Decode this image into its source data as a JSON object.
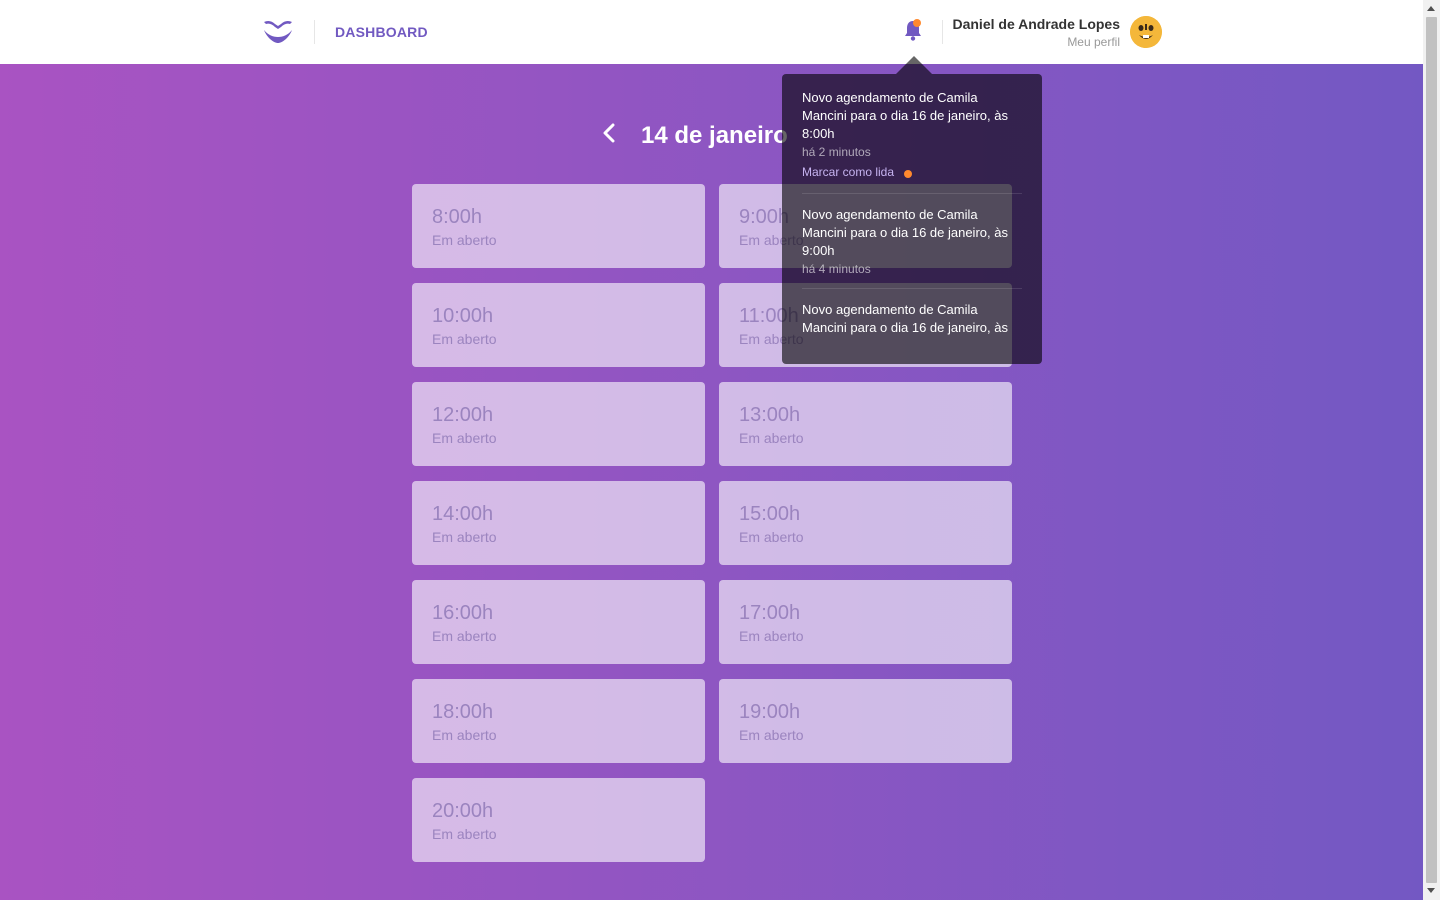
{
  "header": {
    "nav_label": "DASHBOARD",
    "user_name": "Daniel de Andrade Lopes",
    "profile_link": "Meu perfil"
  },
  "schedule": {
    "date_title": "14 de janeiro",
    "slots": [
      {
        "time": "8:00h",
        "status": "Em aberto"
      },
      {
        "time": "9:00h",
        "status": "Em aberto"
      },
      {
        "time": "10:00h",
        "status": "Em aberto"
      },
      {
        "time": "11:00h",
        "status": "Em aberto"
      },
      {
        "time": "12:00h",
        "status": "Em aberto"
      },
      {
        "time": "13:00h",
        "status": "Em aberto"
      },
      {
        "time": "14:00h",
        "status": "Em aberto"
      },
      {
        "time": "15:00h",
        "status": "Em aberto"
      },
      {
        "time": "16:00h",
        "status": "Em aberto"
      },
      {
        "time": "17:00h",
        "status": "Em aberto"
      },
      {
        "time": "18:00h",
        "status": "Em aberto"
      },
      {
        "time": "19:00h",
        "status": "Em aberto"
      },
      {
        "time": "20:00h",
        "status": "Em aberto"
      }
    ]
  },
  "notifications": {
    "mark_read_label": "Marcar como lida",
    "items": [
      {
        "text": "Novo agendamento de Camila Mancini para o dia 16 de janeiro, às 8:00h",
        "time": "há 2 minutos"
      },
      {
        "text": "Novo agendamento de Camila Mancini para o dia 16 de janeiro, às 9:00h",
        "time": "há 4 minutos"
      },
      {
        "text": "Novo agendamento de Camila Mancini para o dia 16 de janeiro, às",
        "time": ""
      }
    ]
  },
  "colors": {
    "brand": "#7159c1",
    "gradient_start": "#a953c2",
    "gradient_end": "#7358c3",
    "unread_dot": "#ff892e"
  },
  "icons": {
    "logo": "mustache-logo",
    "notifications": "bell-icon",
    "back": "chevron-left-icon"
  }
}
